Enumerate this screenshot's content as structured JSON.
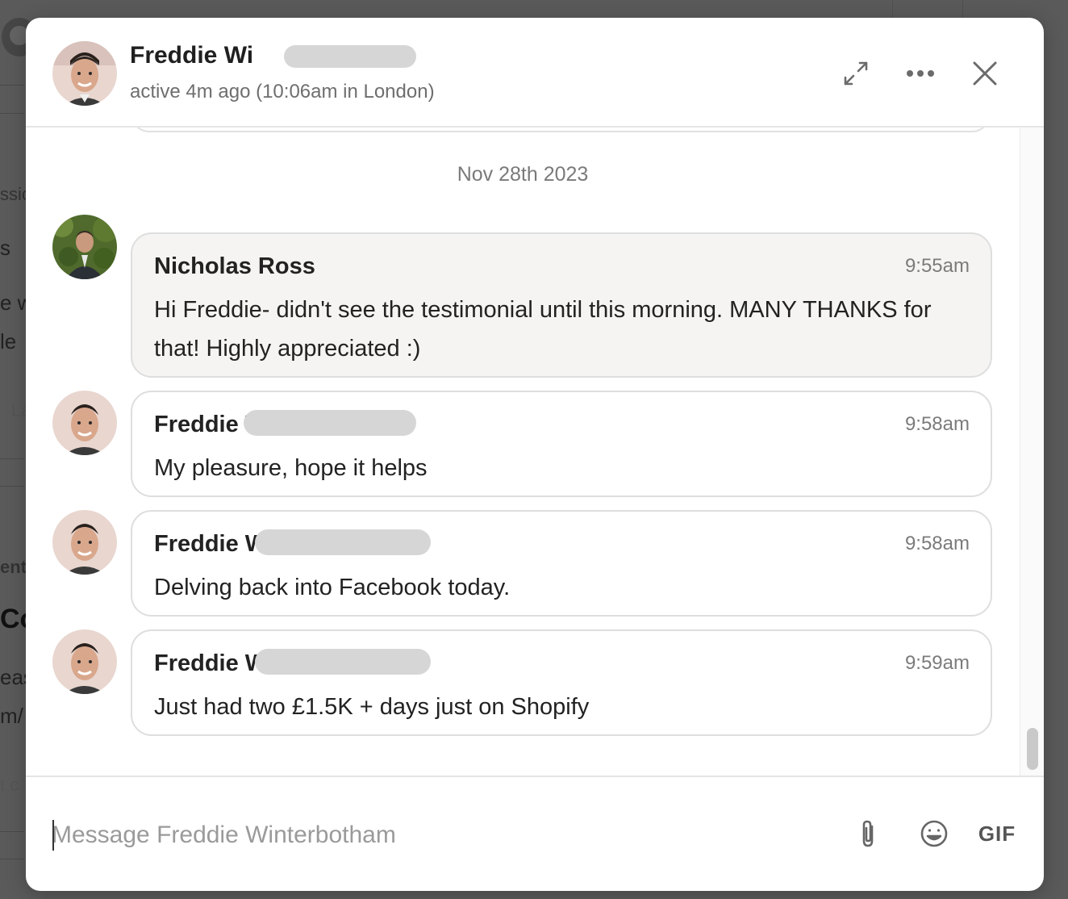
{
  "background_fragments": [
    "ssio",
    "s",
    "e w",
    "le",
    "La",
    "ent",
    "Co",
    "eas",
    "m/",
    "t c"
  ],
  "header": {
    "name": "Freddie Wi",
    "status": "active 4m ago (10:06am in London)",
    "expand_icon": "expand-arrows-icon",
    "more_icon": "more-horizontal-icon",
    "close_icon": "close-icon"
  },
  "date_separator": "Nov 28th 2023",
  "messages": [
    {
      "sender": "Nicholas Ross",
      "time": "9:55am",
      "text": "Hi Freddie- didn't see the testimonial until this morning. MANY THANKS for that! Highly appreciated :)"
    },
    {
      "sender": "Freddie W",
      "time": "9:58am",
      "text": "My pleasure, hope it helps"
    },
    {
      "sender": "Freddie W",
      "time": "9:58am",
      "text": "Delving back into Facebook today."
    },
    {
      "sender": "Freddie W",
      "time": "9:59am",
      "text": "Just had two £1.5K + days just on Shopify"
    }
  ],
  "composer": {
    "placeholder": "Message Freddie Winterbotham",
    "attach_icon": "paperclip-icon",
    "emoji_icon": "emoji-icon",
    "gif_label": "GIF"
  },
  "colors": {
    "own_bubble_bg": "#f5f4f2",
    "border": "#dedede",
    "muted_text": "#7a7a7a",
    "overlay": "#5f5f5f"
  }
}
